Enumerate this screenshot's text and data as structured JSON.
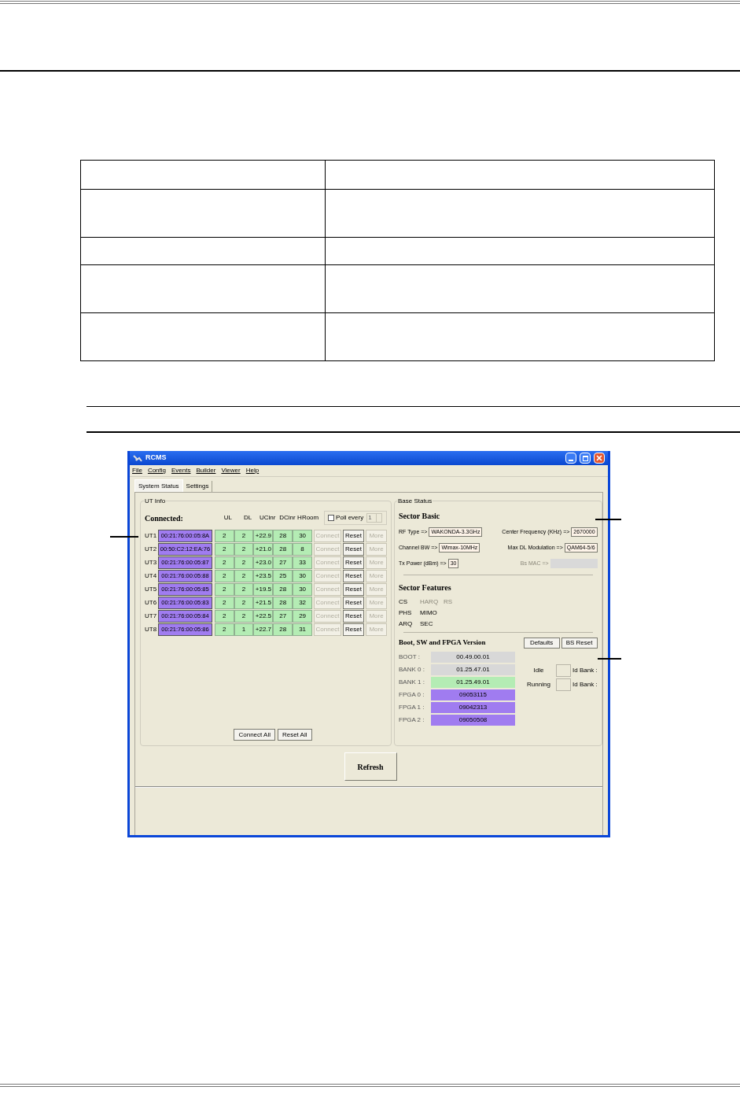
{
  "window": {
    "title": "RCMS",
    "menu": [
      "File",
      "Config",
      "Events",
      "Builder",
      "Viewer",
      "Help"
    ],
    "tabs": [
      {
        "label": "System Status",
        "selected": true
      },
      {
        "label": "Settings",
        "selected": false
      }
    ],
    "ut_info": {
      "title": "UT Info",
      "connected_label": "Connected:",
      "columns": [
        "UL",
        "DL",
        "UCinr",
        "DCinr",
        "HRoom"
      ],
      "poll": {
        "label": "Poll every",
        "checked": false,
        "value": "1"
      },
      "rows": [
        {
          "label": "UT1",
          "mac": "00:21:76:00:05:8A",
          "values": [
            "2",
            "2",
            "+22.9",
            "28",
            "30"
          ],
          "buttons": [
            {
              "label": "Connect",
              "disabled": true
            },
            {
              "label": "Reset",
              "disabled": false
            },
            {
              "label": "More",
              "disabled": true
            }
          ]
        },
        {
          "label": "UT2",
          "mac": "00:50:C2:12:EA:76",
          "values": [
            "2",
            "2",
            "+21.0",
            "28",
            "8"
          ],
          "buttons": [
            {
              "label": "Connect",
              "disabled": true
            },
            {
              "label": "Reset",
              "disabled": false
            },
            {
              "label": "More",
              "disabled": true
            }
          ]
        },
        {
          "label": "UT3",
          "mac": "00:21:76:00:05:87",
          "values": [
            "2",
            "2",
            "+23.0",
            "27",
            "33"
          ],
          "buttons": [
            {
              "label": "Connect",
              "disabled": true
            },
            {
              "label": "Reset",
              "disabled": false
            },
            {
              "label": "More",
              "disabled": true
            }
          ]
        },
        {
          "label": "UT4",
          "mac": "00:21:76:00:05:88",
          "values": [
            "2",
            "2",
            "+23.5",
            "25",
            "30"
          ],
          "buttons": [
            {
              "label": "Connect",
              "disabled": true
            },
            {
              "label": "Reset",
              "disabled": false
            },
            {
              "label": "More",
              "disabled": true
            }
          ]
        },
        {
          "label": "UT5",
          "mac": "00:21:76:00:05:85",
          "values": [
            "2",
            "2",
            "+19.5",
            "28",
            "30"
          ],
          "buttons": [
            {
              "label": "Connect",
              "disabled": true
            },
            {
              "label": "Reset",
              "disabled": false
            },
            {
              "label": "More",
              "disabled": true
            }
          ]
        },
        {
          "label": "UT6",
          "mac": "00:21:76:00:05:83",
          "values": [
            "2",
            "2",
            "+21.5",
            "28",
            "32"
          ],
          "buttons": [
            {
              "label": "Connect",
              "disabled": true
            },
            {
              "label": "Reset",
              "disabled": false
            },
            {
              "label": "More",
              "disabled": true
            }
          ]
        },
        {
          "label": "UT7",
          "mac": "00:21:76:00:05:84",
          "values": [
            "2",
            "2",
            "+22.5",
            "27",
            "29"
          ],
          "buttons": [
            {
              "label": "Connect",
              "disabled": true
            },
            {
              "label": "Reset",
              "disabled": false
            },
            {
              "label": "More",
              "disabled": true
            }
          ]
        },
        {
          "label": "UT8",
          "mac": "00:21:76:00:05:86",
          "values": [
            "2",
            "1",
            "+22.7",
            "28",
            "31"
          ],
          "buttons": [
            {
              "label": "Connect",
              "disabled": true
            },
            {
              "label": "Reset",
              "disabled": false
            },
            {
              "label": "More",
              "disabled": true
            }
          ]
        }
      ],
      "footer_buttons": [
        "Connect All",
        "Reset All"
      ]
    },
    "base_status": {
      "title": "Base Status",
      "sector_basic": {
        "heading": "Sector Basic",
        "fields": [
          {
            "label": "RF Type =>",
            "value": "WAKONDA-3.3GHz",
            "disabled": false
          },
          {
            "label": "Center Frequency (KHz) =>",
            "value": "2670000",
            "disabled": false
          },
          {
            "label": "Channel BW =>",
            "value": "Wimax-10MHz",
            "disabled": false
          },
          {
            "label": "Max DL Modulation =>",
            "value": "QAM64-5/6",
            "disabled": false
          },
          {
            "label": "Tx Power (dBm) =>",
            "value": "30",
            "disabled": false
          },
          {
            "label": "Bs MAC =>",
            "disabled": true
          }
        ]
      },
      "sector_features": {
        "heading": "Sector Features",
        "items": [
          {
            "label": "CS",
            "disabled": false
          },
          {
            "label": "HARQ",
            "disabled": true
          },
          {
            "label": "RS",
            "disabled": true
          },
          {
            "label": "PHS",
            "disabled": false
          },
          {
            "label": "MIMO",
            "disabled": false
          },
          {
            "label": "ARQ",
            "disabled": false
          },
          {
            "label": "SEC",
            "disabled": false
          }
        ]
      },
      "versions": {
        "heading": "Boot, SW and FPGA Version",
        "buttons": [
          "Defaults",
          "BS Reset"
        ],
        "rows": [
          {
            "label": "BOOT :",
            "value": "00.49.00.01",
            "color": "#d8d8d8"
          },
          {
            "label": "BANK 0 :",
            "value": "01.25.47.01",
            "color": "#d8d8d8"
          },
          {
            "label": "BANK 1 :",
            "value": "01.25.49.01",
            "color": "#b4ecb4"
          },
          {
            "label": "FPGA 0 :",
            "value": "09053115",
            "color": "#a07cf0"
          },
          {
            "label": "FPGA 1 :",
            "value": "09042313",
            "color": "#a07cf0"
          },
          {
            "label": "FPGA 2 :",
            "value": "09050508",
            "color": "#a07cf0"
          }
        ],
        "banks": [
          {
            "status": "Idle",
            "label": "Id Bank :"
          },
          {
            "status": "Running",
            "label": "Id Bank :"
          }
        ]
      }
    },
    "refresh_button": "Refresh"
  }
}
